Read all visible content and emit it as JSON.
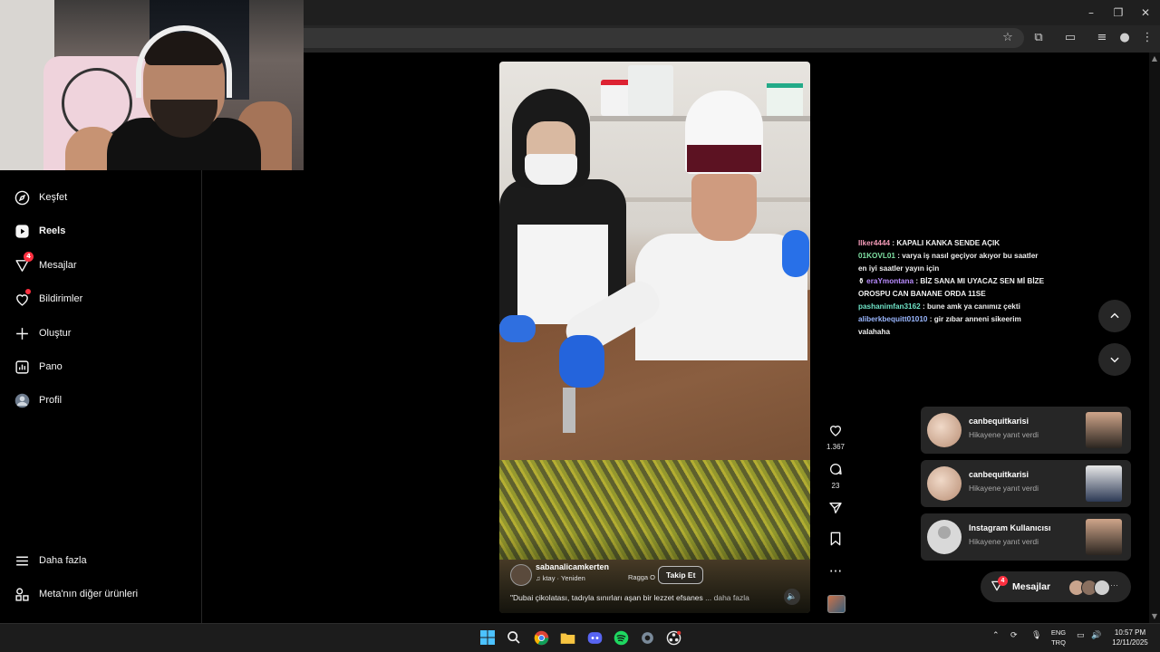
{
  "sidebar": {
    "items": [
      {
        "label": "Keşfet",
        "icon": "compass-icon"
      },
      {
        "label": "Reels",
        "icon": "reels-icon"
      },
      {
        "label": "Mesajlar",
        "icon": "messenger-icon",
        "badge": "4"
      },
      {
        "label": "Bildirimler",
        "icon": "heart-icon"
      },
      {
        "label": "Oluştur",
        "icon": "plus-icon"
      },
      {
        "label": "Pano",
        "icon": "dashboard-icon"
      },
      {
        "label": "Profil",
        "icon": "profile-avatar"
      }
    ],
    "more": "Daha fazla",
    "meta": "Meta'nın diğer ürünleri"
  },
  "reel": {
    "username": "sabanalicamkerten",
    "audio": "ktay · Yeniden",
    "audio2": "Ragga O",
    "follow": "Takip Et",
    "caption": "\"Dubai çikolatası, tadıyla sınırları aşan bir lezzet efsanes",
    "caption_more": "... daha fazla",
    "likes": "1.367",
    "comments": "23"
  },
  "chat": [
    {
      "user": "Ilker4444",
      "msg": ": KAPALI KANKA SENDE AÇIK"
    },
    {
      "user": "01KOVL01",
      "msg": ": varya iş nasıl geçiyor akıyor bu saatler en iyi saatler yayın için"
    },
    {
      "user": "eraYmontana",
      "msg": ": BİZ SANA MI UYACAZ SEN Mİ BİZE OROSPU CAN BANANE ORDA 11SE"
    },
    {
      "user": "pashanimfan3162",
      "msg": ": bune amk ya canımız çekti"
    },
    {
      "user": "aliberkbequitt01010",
      "msg": ": gir zıbar anneni sikeerim valahaha"
    }
  ],
  "notifications": [
    {
      "name": "canbequitkarisi",
      "text": "Hikayene yanıt verdi"
    },
    {
      "name": "canbequitkarisi",
      "text": "Hikayene yanıt verdi"
    },
    {
      "name": "Instagram Kullanıcısı",
      "text": "Hikayene yanıt verdi"
    }
  ],
  "messages_pill": {
    "label": "Mesajlar",
    "badge": "4"
  },
  "taskbar": {
    "lang1": "ENG",
    "lang2": "TRQ",
    "time": "10:57 PM",
    "date": "12/11/2025"
  },
  "colors": {
    "badge": "#ff3040",
    "panel": "#262626",
    "background": "#000000"
  }
}
